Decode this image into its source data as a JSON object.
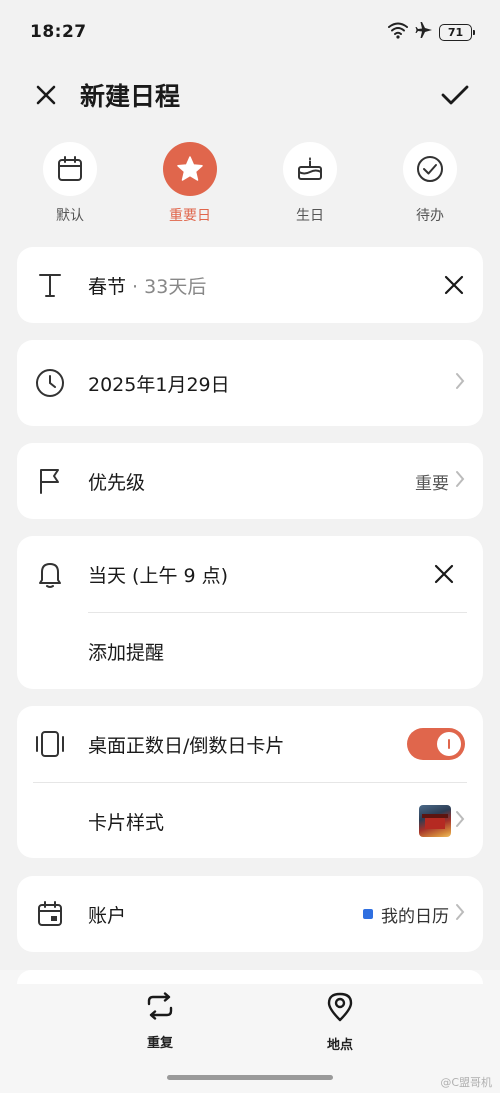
{
  "status_bar": {
    "time": "18:27",
    "battery": "71",
    "wifi_icon": "wifi-icon",
    "airplane_icon": "airplane-icon"
  },
  "header": {
    "title": "新建日程",
    "close_icon": "close-icon",
    "confirm_icon": "check-icon"
  },
  "event_types": [
    {
      "label": "默认",
      "icon": "calendar-icon",
      "active": false
    },
    {
      "label": "重要日",
      "icon": "star-icon",
      "active": true
    },
    {
      "label": "生日",
      "icon": "cake-icon",
      "active": false
    },
    {
      "label": "待办",
      "icon": "check-circle-icon",
      "active": false
    }
  ],
  "title_field": {
    "value": "春节",
    "separator": " · ",
    "countdown": "33天后"
  },
  "date_field": {
    "value": "2025年1月29日"
  },
  "priority": {
    "label": "优先级",
    "value": "重要"
  },
  "reminder": {
    "value": "当天 (上午 9 点)",
    "add_label": "添加提醒"
  },
  "widget": {
    "label": "桌面正数日/倒数日卡片",
    "enabled": true,
    "style_label": "卡片样式"
  },
  "account": {
    "label": "账户",
    "value": "我的日历",
    "color": "#2f6fe0"
  },
  "bottom_actions": [
    {
      "label": "重复",
      "icon": "repeat-icon"
    },
    {
      "label": "地点",
      "icon": "location-icon"
    }
  ],
  "watermark": "@C盟哥机",
  "colors": {
    "accent": "#e0664c",
    "background": "#f2f2f2"
  }
}
